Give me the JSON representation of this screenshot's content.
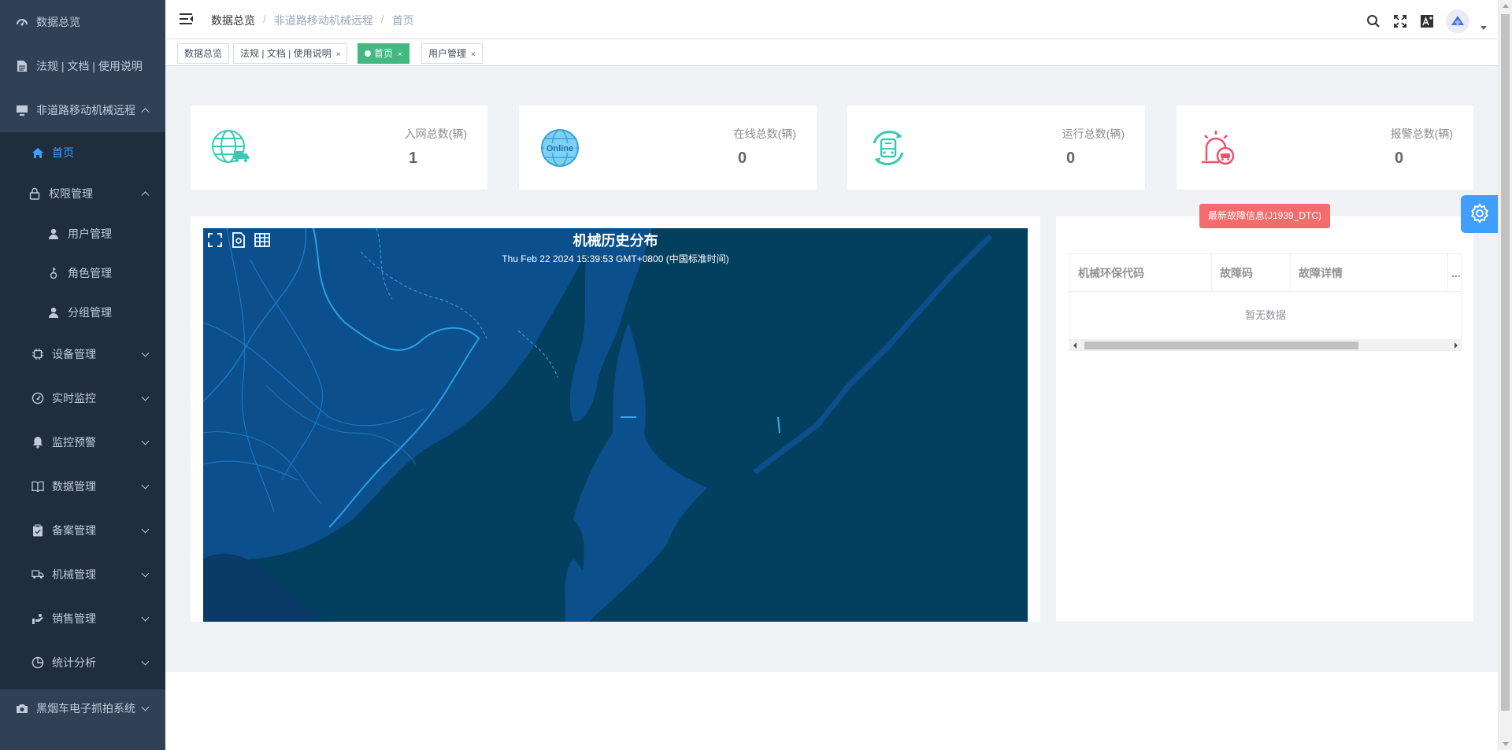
{
  "sidebar": {
    "items": [
      {
        "label": "数据总览",
        "icon": "dashboard-icon"
      },
      {
        "label": "法规 | 文档 | 使用说明",
        "icon": "document-icon"
      },
      {
        "label": "非道路移动机械远程",
        "icon": "monitor-icon"
      },
      {
        "label": "首页",
        "icon": "home-icon"
      },
      {
        "label": "权限管理",
        "icon": "lock-icon"
      },
      {
        "label": "用户管理",
        "icon": "user-icon"
      },
      {
        "label": "角色管理",
        "icon": "role-icon"
      },
      {
        "label": "分组管理",
        "icon": "user-icon"
      },
      {
        "label": "设备管理",
        "icon": "chip-icon"
      },
      {
        "label": "实时监控",
        "icon": "gauge-icon"
      },
      {
        "label": "监控预警",
        "icon": "bell-icon"
      },
      {
        "label": "数据管理",
        "icon": "book-icon"
      },
      {
        "label": "备案管理",
        "icon": "clipboard-icon"
      },
      {
        "label": "机械管理",
        "icon": "truck-icon"
      },
      {
        "label": "销售管理",
        "icon": "sales-icon"
      },
      {
        "label": "统计分析",
        "icon": "pie-icon"
      },
      {
        "label": "黑烟车电子抓拍系统",
        "icon": "camera-icon"
      }
    ]
  },
  "breadcrumb": [
    "数据总览",
    "非道路移动机械远程",
    "首页"
  ],
  "tags": [
    {
      "label": "数据总览",
      "closable": false
    },
    {
      "label": "法规 | 文档 | 使用说明",
      "closable": true
    },
    {
      "label": "首页",
      "closable": true,
      "active": true
    },
    {
      "label": "用户管理",
      "closable": true
    }
  ],
  "tag_close_glyph": "×",
  "stats": [
    {
      "label": "入网总数(辆)",
      "value": "1",
      "icon": "globe-truck-icon"
    },
    {
      "label": "在线总数(辆)",
      "value": "0",
      "icon": "online-globe-icon"
    },
    {
      "label": "运行总数(辆)",
      "value": "0",
      "icon": "running-bus-icon"
    },
    {
      "label": "报警总数(辆)",
      "value": "0",
      "icon": "alarm-siren-icon"
    }
  ],
  "map": {
    "title": "机械历史分布",
    "timestamp": "Thu Feb 22 2024 15:39:53 GMT+0800 (中国标准时间)"
  },
  "fault": {
    "badge": "最新故障信息(J1939_DTC)",
    "columns": [
      "机械环保代码",
      "故障码",
      "故障详情",
      "..."
    ],
    "empty_text": "暂无数据"
  },
  "colors": {
    "sidebar_bg": "#304156",
    "accent": "#409eff",
    "tag_active": "#42b983",
    "alarm": "#f56c6c",
    "map_sea": "#033f5e",
    "map_land": "#0b4f8c"
  }
}
